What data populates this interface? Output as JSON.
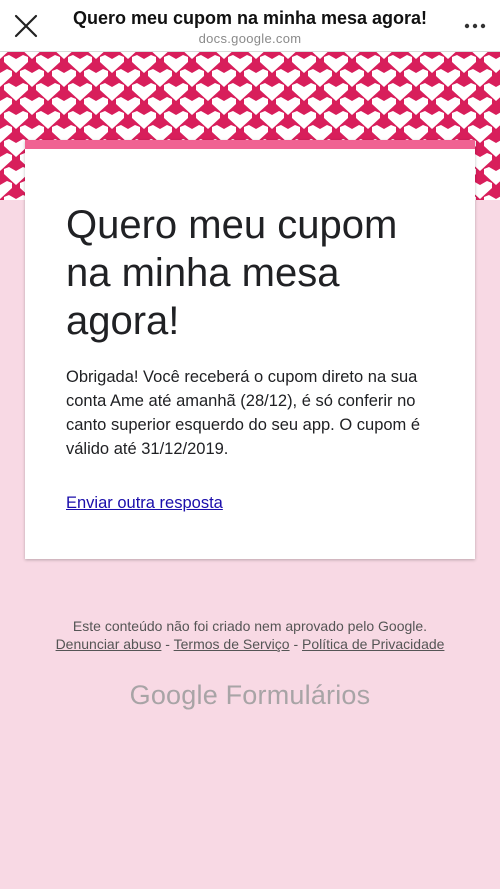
{
  "browser": {
    "title": "Quero meu cupom na minha mesa agora!",
    "url": "docs.google.com"
  },
  "card": {
    "title": "Quero meu cupom na minha mesa agora!",
    "message": "Obrigada! Você receberá o cupom direto na sua conta Ame até amanhã (28/12), é só conferir no canto superior esquerdo do seu app. O cupom é válido até 31/12/2019.",
    "link_label": "Enviar outra resposta"
  },
  "footer": {
    "disclaimer": "Este conteúdo não foi criado nem aprovado pelo Google.",
    "links": [
      "Denunciar abuso",
      "Termos de Serviço",
      "Política de Privacidade"
    ],
    "separator": " - ",
    "logo_google": "Google",
    "logo_product": "Formulários"
  },
  "colors": {
    "accent": "#f06292",
    "header_pattern": "#d81e5b",
    "page_background": "#f8d9e4",
    "link": "#1a0dab"
  }
}
